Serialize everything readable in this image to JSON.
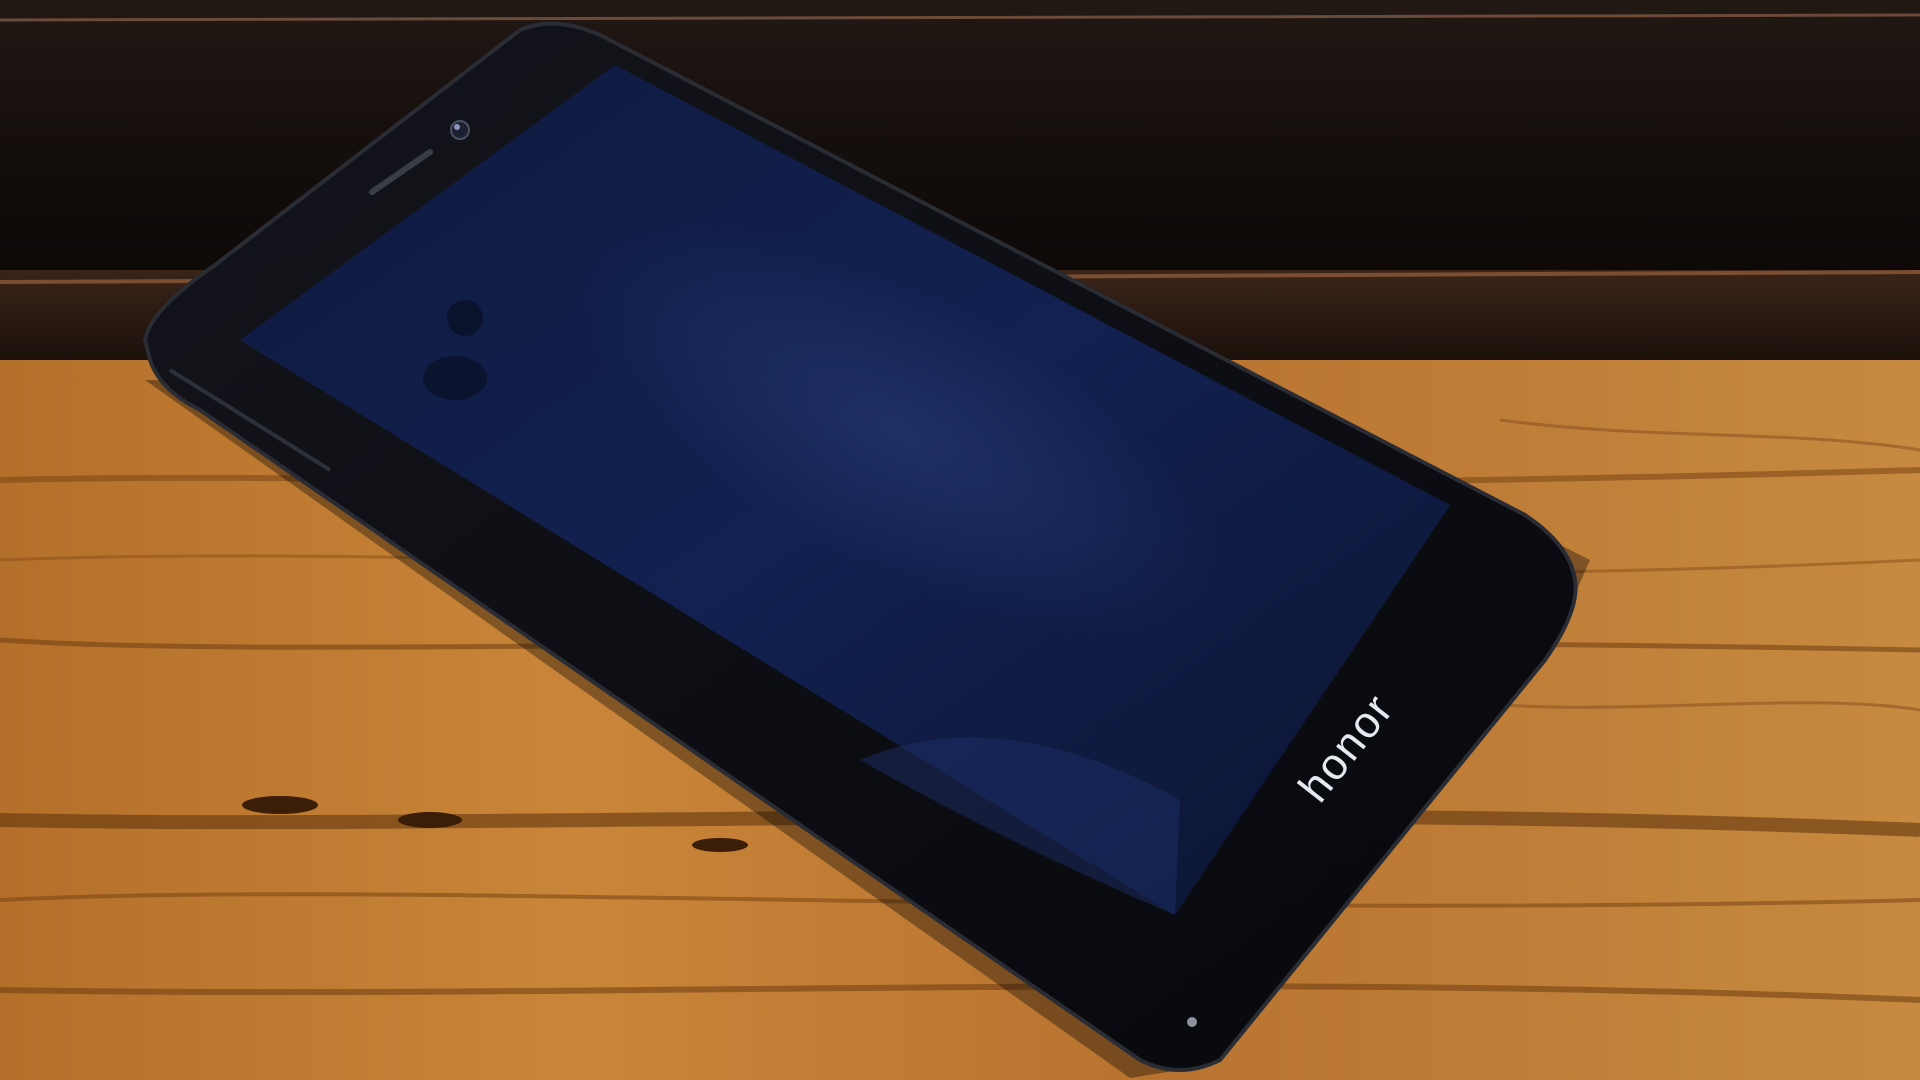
{
  "scene": {
    "subject": "smartphone",
    "setting": "wooden table"
  },
  "phone": {
    "brand_logo": "honor",
    "screen_state": "off",
    "color": "black"
  },
  "colors": {
    "wood_light": "#c07a2c",
    "wood_mid": "#9a5a1c",
    "wood_dark": "#5e3210",
    "background_dark": "#16100d",
    "phone_body": "#0c0d12",
    "screen": "#101a3a",
    "logo": "#e6e9f0"
  }
}
